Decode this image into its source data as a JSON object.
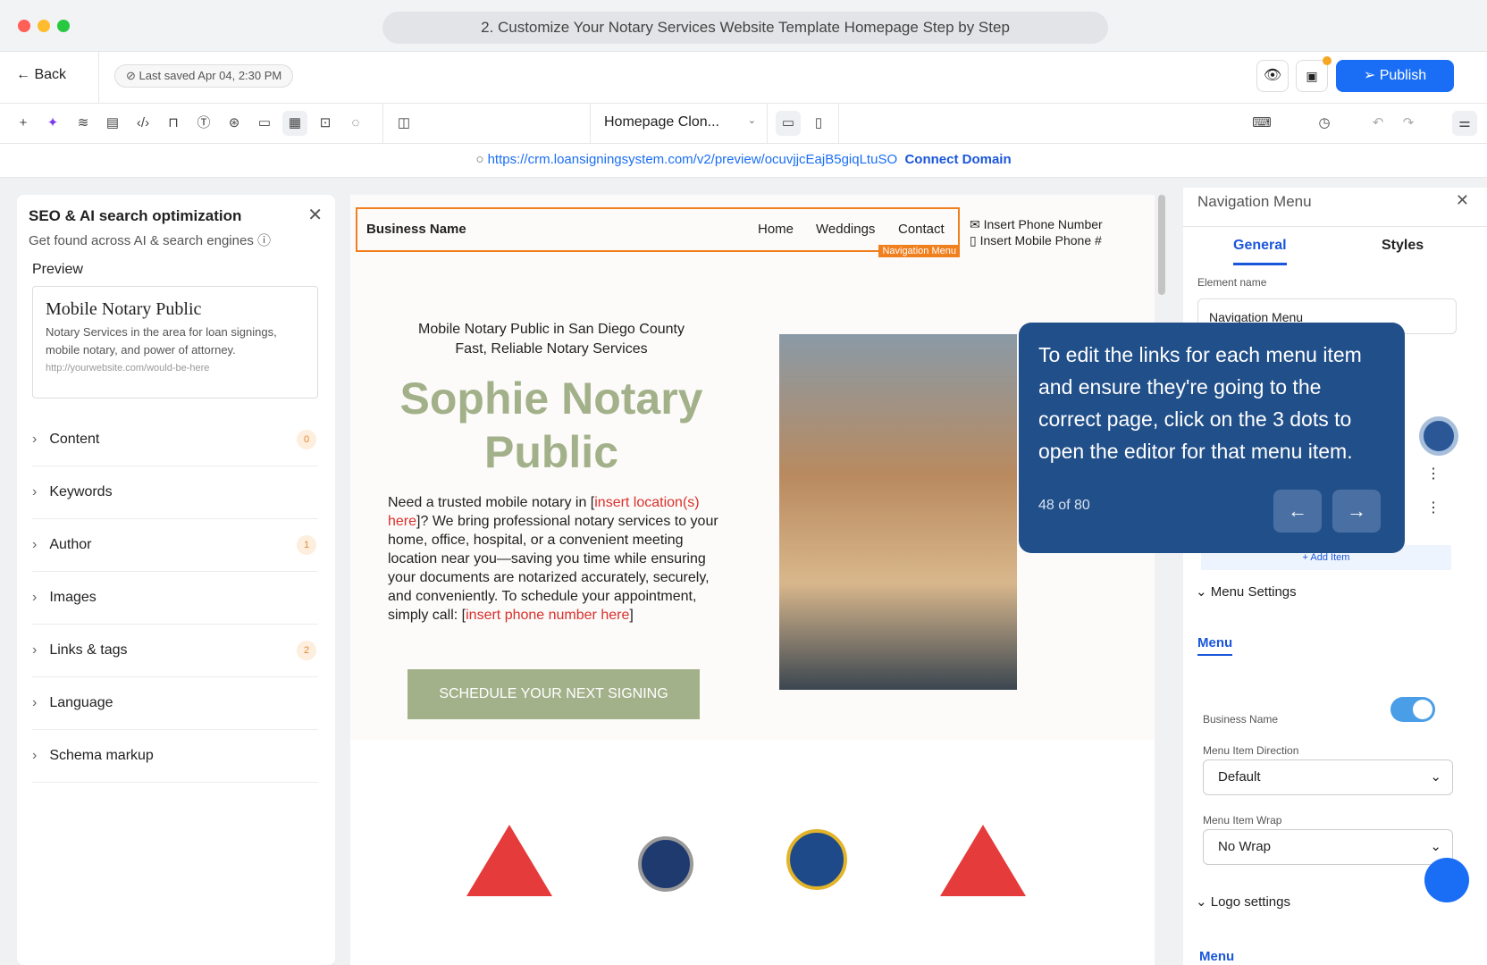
{
  "window": {
    "title": "2. Customize Your Notary Services Website Template Homepage Step by Step"
  },
  "header": {
    "back": "Back",
    "last_saved": "Last saved Apr 04, 2:30 PM",
    "publish": "Publish"
  },
  "toolbar": {
    "page_select": "Homepage Clon...",
    "icons": [
      "plus-icon",
      "ai-sparkle-icon",
      "layers-icon",
      "pages-icon",
      "code-icon",
      "paint-icon",
      "text-icon",
      "color-icon",
      "section-icon",
      "seo-icon",
      "terminal-icon",
      "cookie-icon",
      "split-icon"
    ]
  },
  "url": {
    "link": "https://crm.loansigningsystem.com/v2/preview/ocuvjjcEajB5giqLtuSO",
    "connect": "Connect Domain"
  },
  "seo": {
    "title": "SEO & AI search optimization",
    "subtitle": "Get found across AI & search engines",
    "preview_label": "Preview",
    "preview_title": "Mobile Notary Public",
    "preview_desc": "Notary Services in the area for loan signings, mobile notary, and power of attorney.",
    "preview_url": "http://yourwebsite.com/would-be-here",
    "items": [
      {
        "label": "Content",
        "badge": "0"
      },
      {
        "label": "Keywords"
      },
      {
        "label": "Author",
        "badge": "1"
      },
      {
        "label": "Images"
      },
      {
        "label": "Links & tags",
        "badge": "2"
      },
      {
        "label": "Language"
      },
      {
        "label": "Schema markup"
      }
    ]
  },
  "site": {
    "business": "Business Name",
    "nav": [
      "Home",
      "Weddings",
      "Contact"
    ],
    "nav_tag": "Navigation Menu",
    "phone": "Insert Phone Number",
    "mobile": "Insert Mobile Phone #",
    "tagline1": "Mobile Notary Public in San Diego County",
    "tagline2": "Fast, Reliable Notary Services",
    "heading": "Sophie Notary Public",
    "body_a": "Need a trusted mobile notary in [",
    "body_red1": "insert location(s) here",
    "body_b": "]? We bring professional notary services to your home, office, hospital, or a convenient meeting location near you—saving you time while ensuring your documents are notarized accurately, securely, and conveniently. To schedule your appointment, simply call: [",
    "body_red2": "insert phone number here",
    "body_c": "]",
    "cta": "SCHEDULE YOUR NEXT SIGNING",
    "accent": "#a3b18a"
  },
  "panel": {
    "title": "Navigation Menu",
    "tabs": [
      "General",
      "Styles"
    ],
    "element_name_label": "Element name",
    "element_name_value": "Navigation Menu",
    "add_item": "+ Add Item",
    "menu_settings": "Menu Settings",
    "menu_tab": "Menu",
    "business_name_label": "Business Name",
    "business_name_on": true,
    "direction_label": "Menu Item Direction",
    "direction_value": "Default",
    "wrap_label": "Menu Item Wrap",
    "wrap_value": "No Wrap",
    "logo_settings": "Logo settings",
    "menu2": "Menu"
  },
  "tour": {
    "text": "To edit the links for each menu item and ensure they're going to the correct page, click on the 3 dots to open the editor for that menu item.",
    "progress": "48 of 80",
    "step": 48,
    "total": 80,
    "color": "#214f89"
  }
}
